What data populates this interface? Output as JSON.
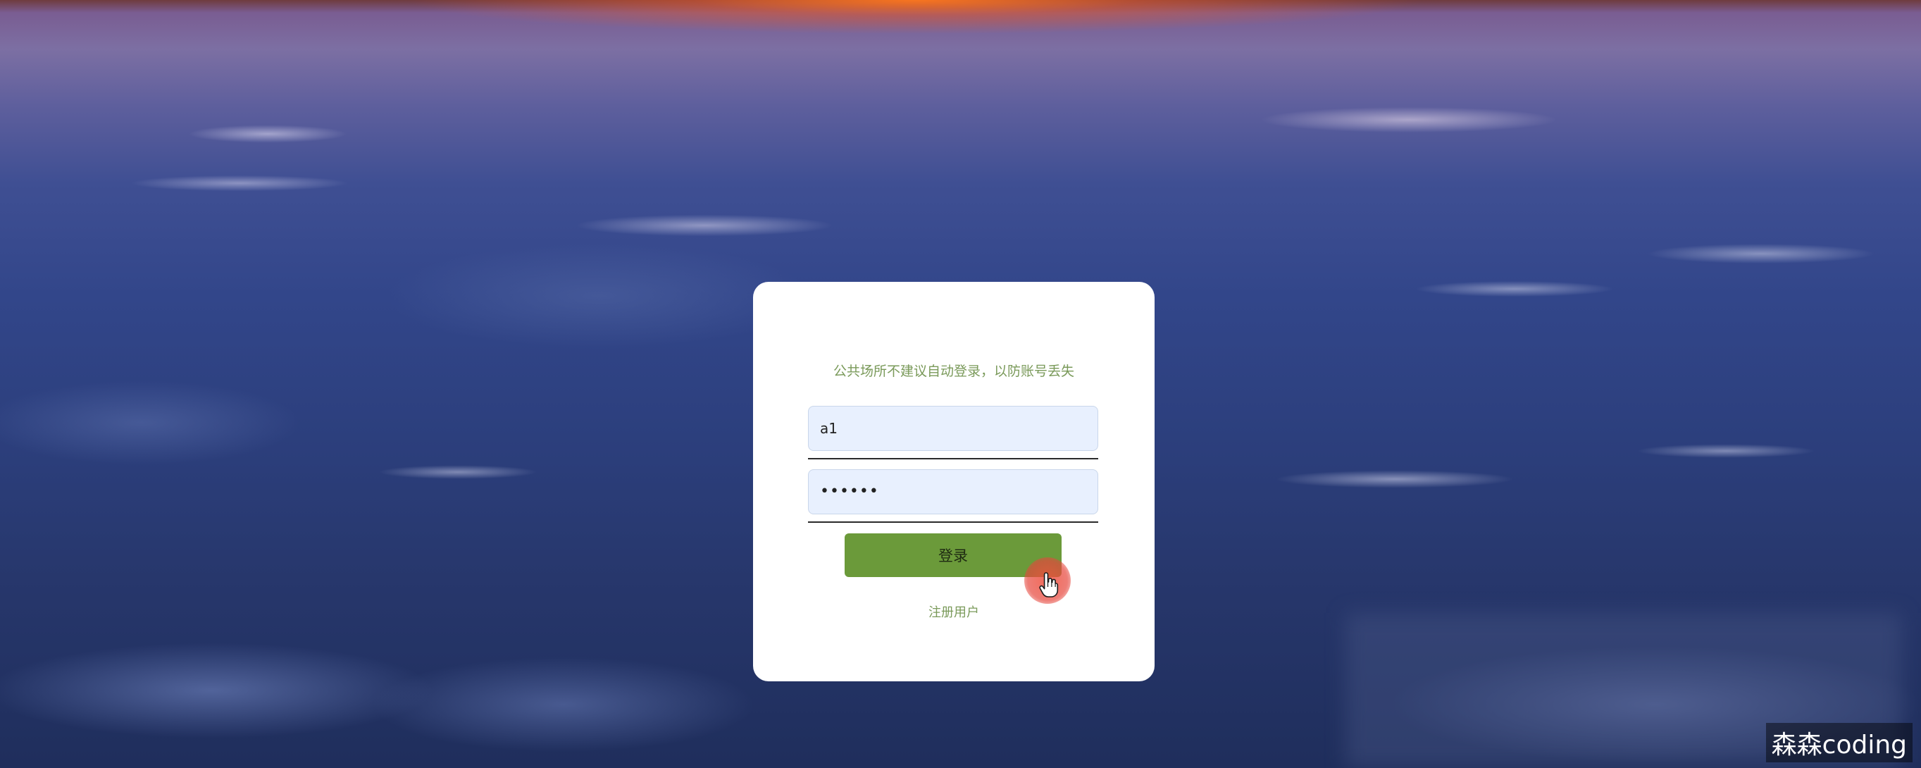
{
  "login": {
    "notice": "公共场所不建议自动登录，以防账号丢失",
    "username_value": "a1",
    "password_value": "••••••",
    "login_button_label": "登录",
    "register_link_label": "注册用户"
  },
  "cursor": {
    "icon": "hand-pointer-icon",
    "highlight_color": "#e8503c"
  },
  "watermark": {
    "text": "森森coding"
  },
  "colors": {
    "card_background": "#ffffff",
    "accent_green": "#6b9a3a",
    "notice_text": "#7a9a5a",
    "input_background": "#e8f0fe"
  }
}
